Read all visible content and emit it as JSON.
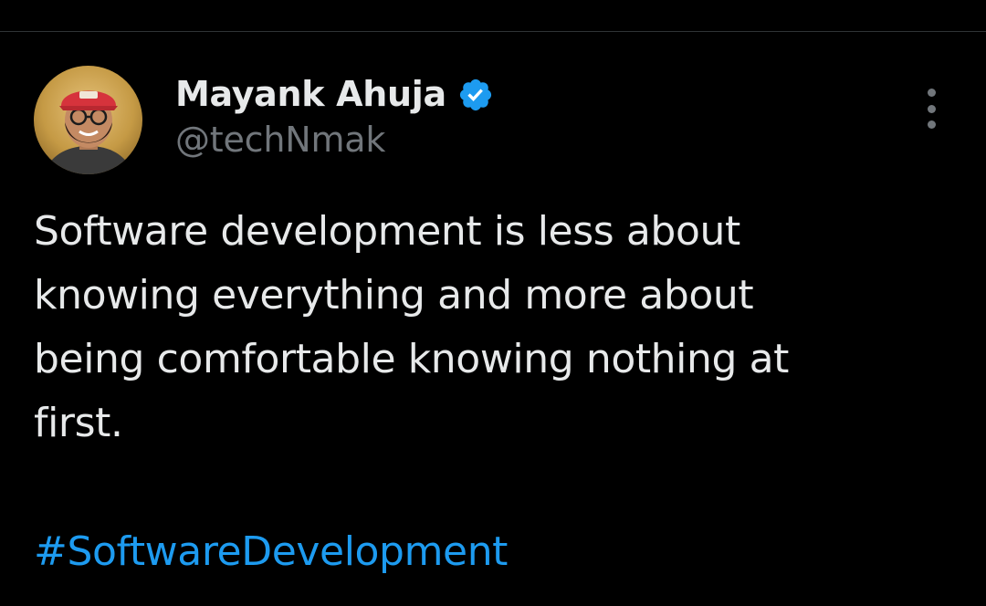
{
  "colors": {
    "background": "#000000",
    "primary_text": "#e7e9ea",
    "secondary_text": "#71767b",
    "accent": "#1d9bf0",
    "divider": "#2f3336"
  },
  "author": {
    "name": "Mayank Ahuja",
    "handle": "@techNmak",
    "verified": true,
    "verified_icon": "verified-badge-icon",
    "avatar_icon": "profile-avatar"
  },
  "menu": {
    "icon": "more-vertical-icon"
  },
  "tweet": {
    "text_lines": [
      "Software development is less about",
      "knowing everything and more about",
      "being comfortable knowing nothing at",
      "first."
    ],
    "hashtag": "#SoftwareDevelopment"
  }
}
